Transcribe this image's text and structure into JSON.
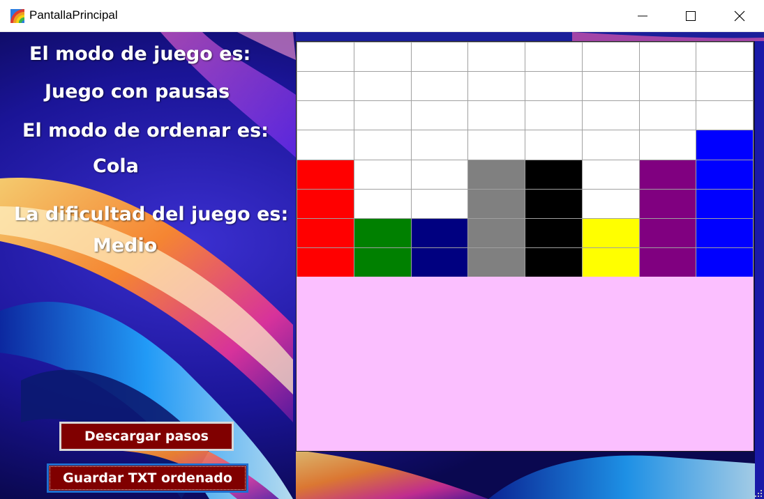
{
  "window": {
    "title": "PantallaPrincipal",
    "icon": "app-rainbow-icon",
    "controls": [
      "minimize-icon",
      "maximize-icon",
      "close-icon"
    ]
  },
  "labels": {
    "game_mode_title": "El modo de juego es:",
    "game_mode_value": "Juego con pausas",
    "sort_mode_title": "El modo de ordenar es:",
    "sort_mode_value": "Cola",
    "difficulty_title": "La dificultad del juego es:",
    "difficulty_value": "Medio"
  },
  "board": {
    "columns": 8,
    "rows": 8,
    "background_color": "#fbbfff",
    "columns_colors": [
      [
        "#ffffff",
        "#ffffff",
        "#ffffff",
        "#ffffff",
        "#ff0000",
        "#ff0000",
        "#ff0000",
        "#ff0000"
      ],
      [
        "#ffffff",
        "#ffffff",
        "#ffffff",
        "#ffffff",
        "#ffffff",
        "#ffffff",
        "#008000",
        "#008000"
      ],
      [
        "#ffffff",
        "#ffffff",
        "#ffffff",
        "#ffffff",
        "#ffffff",
        "#ffffff",
        "#000080",
        "#000080"
      ],
      [
        "#ffffff",
        "#ffffff",
        "#ffffff",
        "#ffffff",
        "#808080",
        "#808080",
        "#808080",
        "#808080"
      ],
      [
        "#ffffff",
        "#ffffff",
        "#ffffff",
        "#ffffff",
        "#000000",
        "#000000",
        "#000000",
        "#000000"
      ],
      [
        "#ffffff",
        "#ffffff",
        "#ffffff",
        "#ffffff",
        "#ffffff",
        "#ffffff",
        "#ffff00",
        "#ffff00"
      ],
      [
        "#ffffff",
        "#ffffff",
        "#ffffff",
        "#ffffff",
        "#800080",
        "#800080",
        "#800080",
        "#800080"
      ],
      [
        "#ffffff",
        "#ffffff",
        "#ffffff",
        "#0000ff",
        "#0000ff",
        "#0000ff",
        "#0000ff",
        "#0000ff"
      ]
    ]
  },
  "buttons": {
    "download_steps": "Descargar pasos",
    "save_sorted_txt": "Guardar TXT ordenado"
  },
  "colors": {
    "button_bg": "#800000",
    "focus_border": "#1e6fd0"
  }
}
